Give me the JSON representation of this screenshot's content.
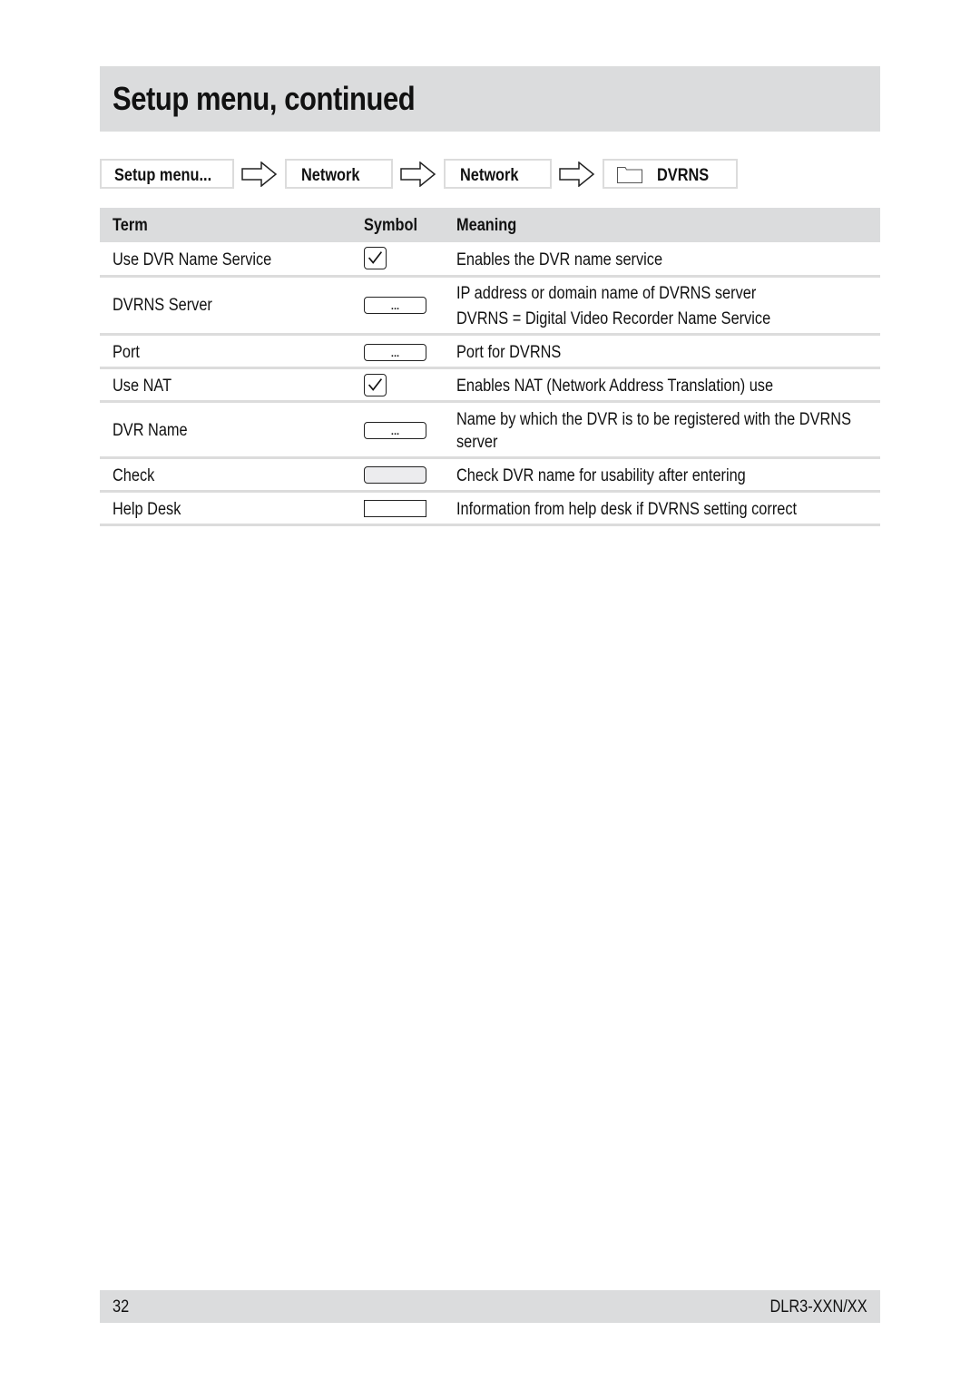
{
  "page": {
    "title": "Setup menu, continued"
  },
  "breadcrumb": {
    "items": [
      {
        "label": "Setup menu..."
      },
      {
        "label": "Network"
      },
      {
        "label": "Network"
      },
      {
        "label": "DVRNS",
        "icon": "folder-icon"
      }
    ],
    "separator_icon": "arrow-right-icon"
  },
  "table": {
    "headers": {
      "term": "Term",
      "symbol": "Symbol",
      "meaning": "Meaning"
    },
    "rows": [
      {
        "term": "Use DVR Name Service",
        "symbol": "checkbox-checked",
        "meaning": [
          "Enables the DVR name service"
        ]
      },
      {
        "term": "DVRNS Server",
        "symbol": "input-field",
        "symbol_text": "...",
        "meaning": [
          "IP address or domain name of DVRNS server",
          "DVRNS = Digital Video Recorder Name Service"
        ]
      },
      {
        "term": "Port",
        "symbol": "input-field",
        "symbol_text": "...",
        "meaning": [
          "Port for DVRNS"
        ]
      },
      {
        "term": "Use NAT",
        "symbol": "checkbox-checked",
        "meaning": [
          "Enables NAT (Network Address Translation) use"
        ]
      },
      {
        "term": "DVR Name",
        "symbol": "input-field",
        "symbol_text": "...",
        "meaning": [
          "Name by which the DVR is to be registered with the DVRNS",
          "server"
        ]
      },
      {
        "term": "Check",
        "symbol": "button",
        "meaning": [
          "Check DVR name for usability after entering"
        ]
      },
      {
        "term": "Help Desk",
        "symbol": "display-field",
        "meaning": [
          "Information from help desk if DVRNS setting correct"
        ]
      }
    ]
  },
  "footer": {
    "page_number": "32",
    "model": "DLR3-XXN/XX"
  }
}
